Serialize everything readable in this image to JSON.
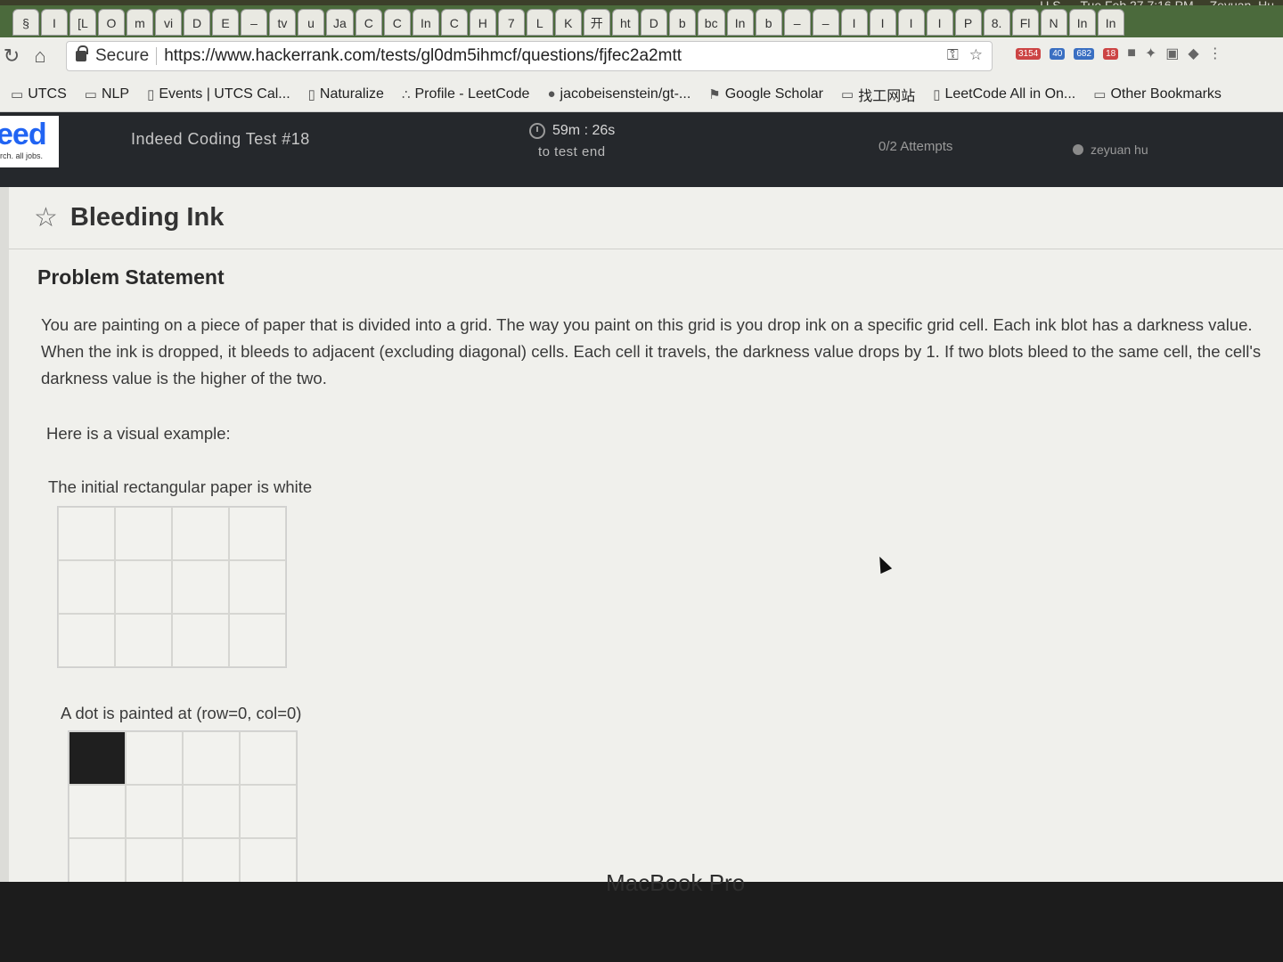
{
  "menubar": {
    "region": "U.S.",
    "datetime": "Tue Feb 27  7:16 PM",
    "user": "Zeyuan_Hu"
  },
  "tabs": [
    "§",
    "I",
    "[L",
    "O",
    "m",
    "vi",
    "D",
    "E",
    "–",
    "tv",
    "u",
    "Ja",
    "C",
    "C",
    "In",
    "C",
    "H",
    "7",
    "L",
    "K",
    "开",
    "ht",
    "D",
    "b",
    "bc",
    "In",
    "b",
    "–",
    "–",
    "I",
    "I",
    "I",
    "I",
    "P",
    "8.",
    "Fl",
    "N",
    "In",
    "In"
  ],
  "toolbar": {
    "secure_label": "Secure",
    "url": "https://www.hackerrank.com/tests/gl0dm5ihmcf/questions/fjfec2a2mtt",
    "ext_badges": [
      "3154",
      "40",
      "682",
      "18"
    ]
  },
  "bookmarks": [
    {
      "icon": "folder-icon",
      "label": "UTCS"
    },
    {
      "icon": "folder-icon",
      "label": "NLP"
    },
    {
      "icon": "page-icon",
      "label": "Events | UTCS Cal..."
    },
    {
      "icon": "page-icon",
      "label": "Naturalize"
    },
    {
      "icon": "leetcode-icon",
      "label": "Profile - LeetCode"
    },
    {
      "icon": "github-icon",
      "label": "jacobeisenstein/gt-..."
    },
    {
      "icon": "scholar-icon",
      "label": "Google Scholar"
    },
    {
      "icon": "folder-icon",
      "label": "找工网站"
    },
    {
      "icon": "page-icon",
      "label": "LeetCode All in On..."
    },
    {
      "icon": "folder-icon",
      "label": "Other Bookmarks"
    }
  ],
  "header": {
    "logo_text": "eed",
    "logo_tagline": "rch. all jobs.",
    "test_title": "Indeed Coding Test #18",
    "timer": "59m : 26s",
    "timer_sub": "to test end",
    "attempts": "0/2 Attempts",
    "user": "zeyuan hu"
  },
  "problem": {
    "title": "Bleeding Ink",
    "section_title": "Problem Statement",
    "statement": "You are painting on a piece of paper that is divided into a grid. The way you paint on this grid is you drop ink on a specific grid cell. Each ink blot has a darkness value. When the ink is dropped, it bleeds to adjacent (excluding diagonal) cells. Each cell it travels, the darkness value drops by 1. If two blots bleed to the same cell, the cell's darkness value is the higher of the two.",
    "visual_example_label": "Here is a visual example:",
    "initial_label": "The initial rectangular paper is white",
    "dot_label": "A dot is painted at (row=0, col=0)",
    "grid_initial_inked": [
      false,
      false,
      false,
      false,
      false,
      false,
      false,
      false,
      false,
      false,
      false,
      false
    ],
    "grid_dot_inked": [
      true,
      false,
      false,
      false,
      false,
      false,
      false,
      false,
      false,
      false,
      false,
      false
    ]
  },
  "bezel": {
    "label": "MacBook Pro"
  }
}
